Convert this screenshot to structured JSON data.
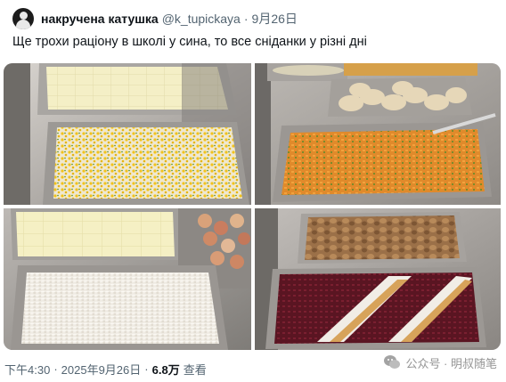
{
  "tweet": {
    "author_name": "накручена катушка",
    "handle": "@k_tupickaya",
    "separator": "·",
    "date": "9月26日",
    "text": "Ще трохи раціону в школі у сина, то все сніданки у різні дні"
  },
  "photos": [
    {
      "icon": "cafeteria-trays-corn-rice-photo"
    },
    {
      "icon": "cafeteria-trays-chicken-carrots-photo"
    },
    {
      "icon": "cafeteria-trays-cheese-rice-peaches-photo"
    },
    {
      "icon": "cafeteria-trays-meat-beet-salad-photo"
    }
  ],
  "footer": {
    "time": "下午4:30",
    "dot": "·",
    "date": "2025年9月26日",
    "views_count": "6.8万",
    "views_label": "查看"
  },
  "watermark": {
    "label": "公众号 · 明叔随笔"
  },
  "colors": {
    "text_primary": "#0f1419",
    "text_secondary": "#536471"
  }
}
